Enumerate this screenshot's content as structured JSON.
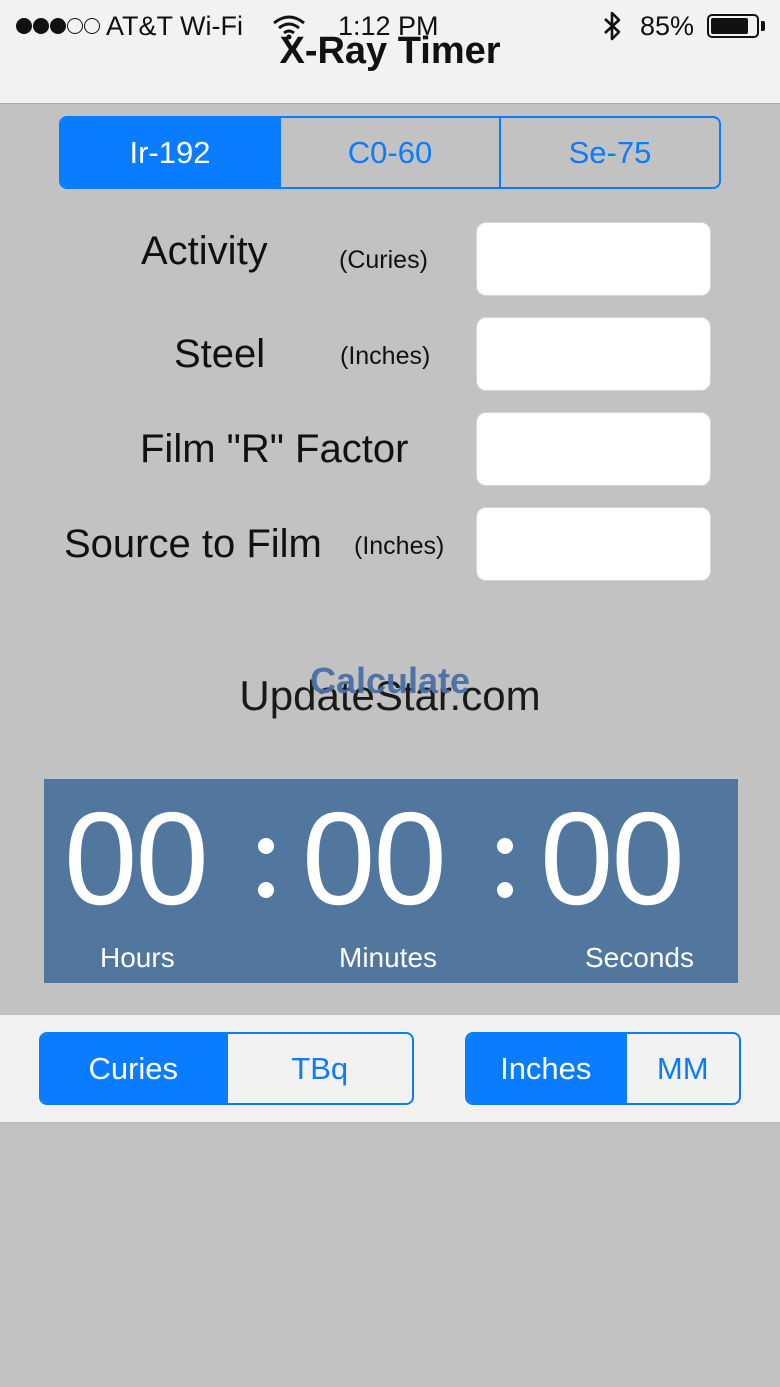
{
  "status_bar": {
    "carrier": "AT&T Wi-Fi",
    "time": "1:12 PM",
    "battery": "85%",
    "battery_level": 0.85,
    "signal_bars_filled": 3,
    "signal_bars_total": 5
  },
  "nav": {
    "title": "X-Ray Timer"
  },
  "isotope_tabs": [
    {
      "label": "Ir-192",
      "selected": true
    },
    {
      "label": "C0-60",
      "selected": false
    },
    {
      "label": "Se-75",
      "selected": false
    }
  ],
  "fields": {
    "activity": {
      "label": "Activity",
      "unit": "(Curies)",
      "value": ""
    },
    "steel": {
      "label": "Steel",
      "unit": "(Inches)",
      "value": ""
    },
    "film_factor": {
      "label": "Film \"R\" Factor",
      "value": ""
    },
    "source_to_film": {
      "label": "Source to Film",
      "unit": "(Inches)",
      "value": ""
    }
  },
  "calculate_label": "Calculate",
  "watermark": "UpdateStar.com",
  "timer": {
    "hours": "00",
    "minutes": "00",
    "seconds": "00",
    "hours_label": "Hours",
    "minutes_label": "Minutes",
    "seconds_label": "Seconds"
  },
  "activity_units": [
    {
      "label": "Curies",
      "selected": true
    },
    {
      "label": "TBq",
      "selected": false
    }
  ],
  "distance_units": [
    {
      "label": "Inches",
      "selected": true
    },
    {
      "label": "MM",
      "selected": false
    }
  ],
  "colors": {
    "accent": "#0a7cff",
    "timer_panel": "#52779e",
    "background": "#c2c2c2"
  }
}
